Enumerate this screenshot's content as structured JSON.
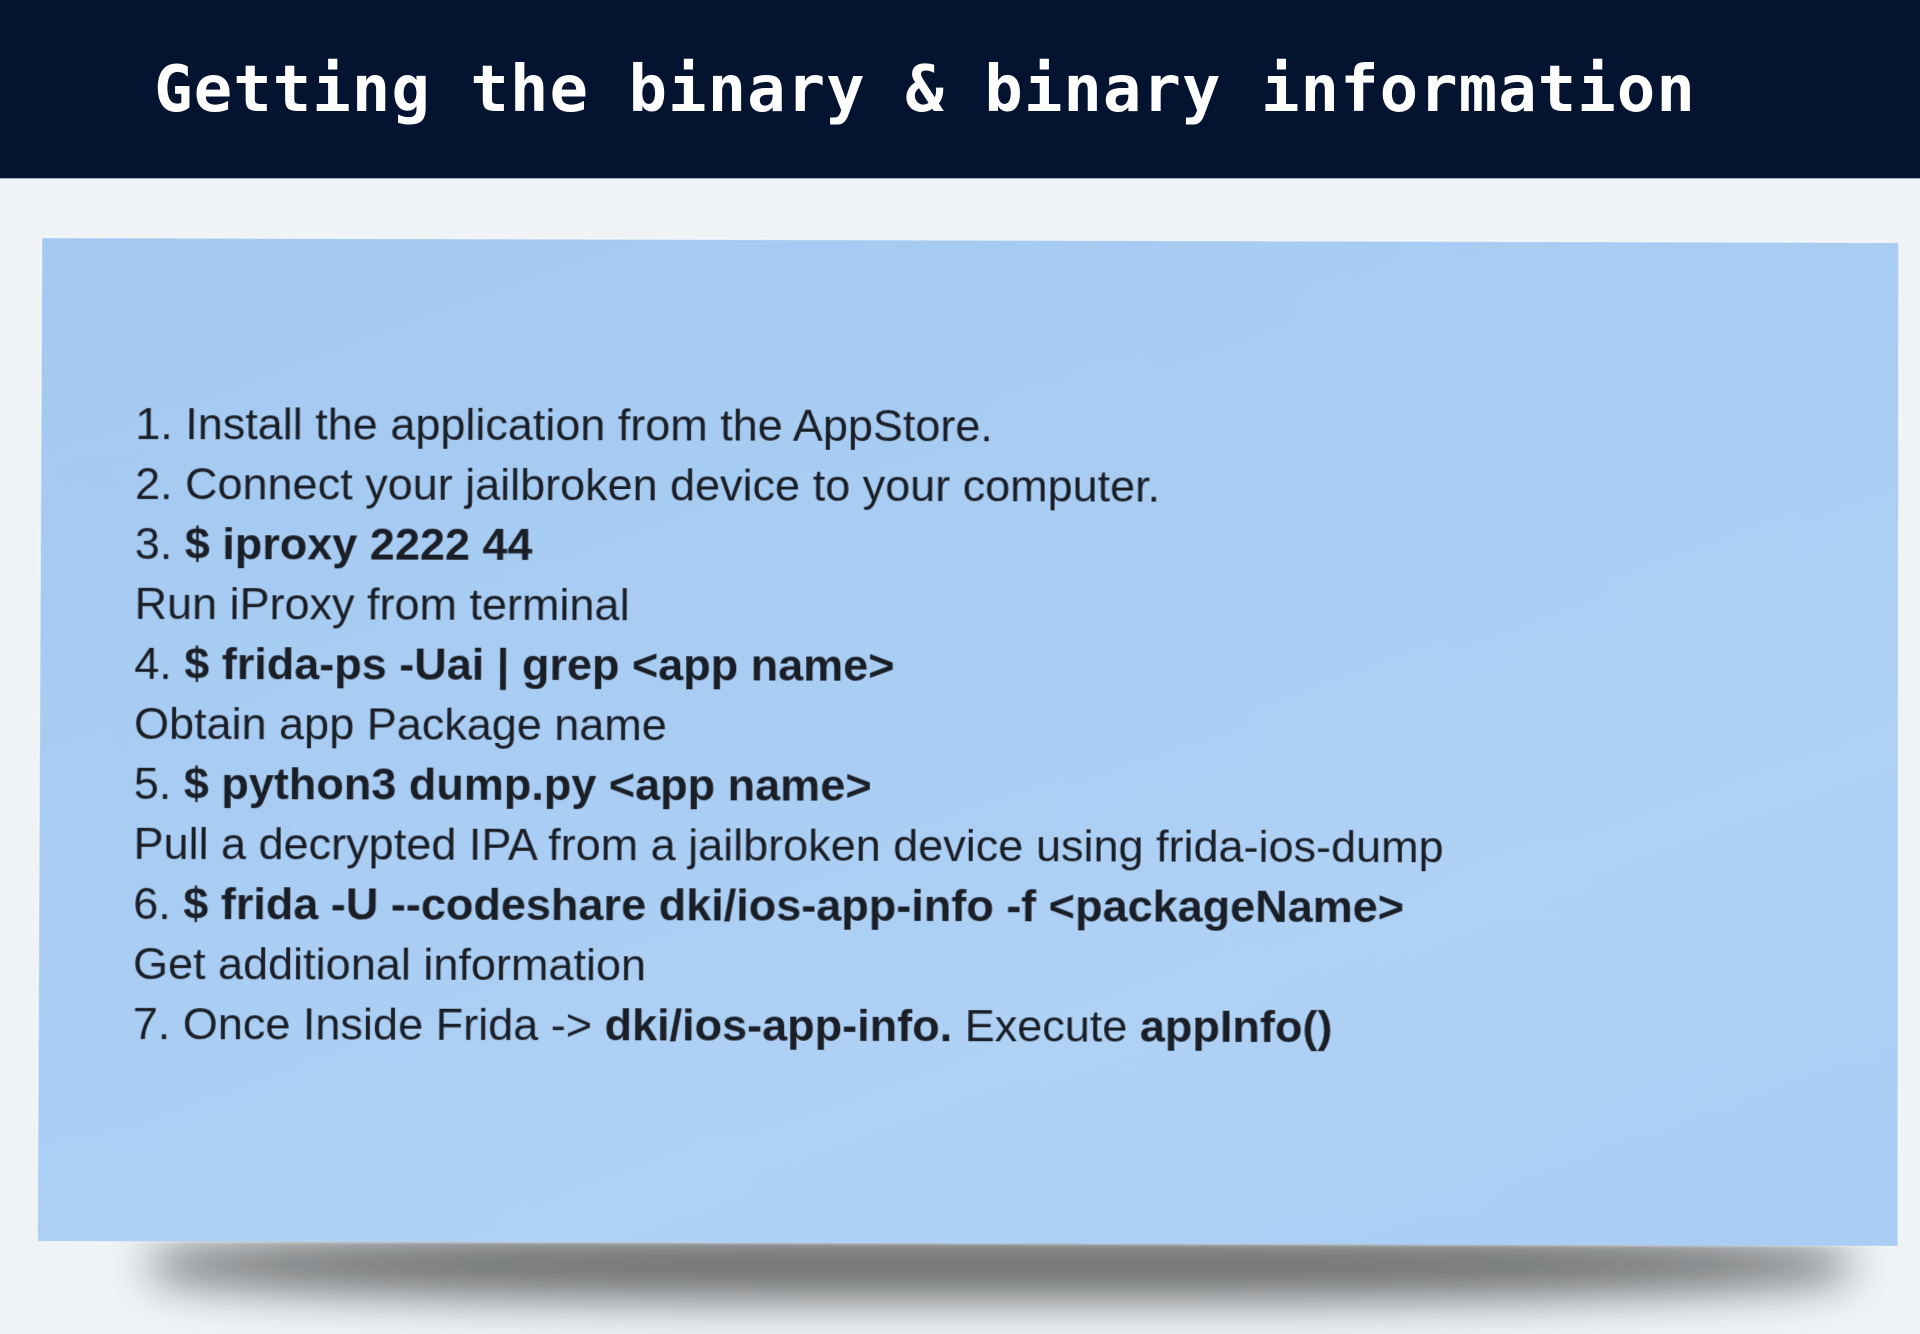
{
  "header": {
    "title": "Getting the binary & binary information"
  },
  "colors": {
    "header_bg": "#041430",
    "header_text": "#ffffff",
    "page_bg": "#eff3f6",
    "card_bg": "#a9cdf3",
    "body_text": "#1a1e26"
  },
  "steps": [
    {
      "prefix": "1. Install the application from the AppStore.",
      "cmd": "",
      "mid": "",
      "cmd2": ""
    },
    {
      "prefix": "2. Connect your jailbroken device to your computer.",
      "cmd": "",
      "mid": "",
      "cmd2": ""
    },
    {
      "prefix": "3. ",
      "cmd": "$ iproxy 2222 44",
      "mid": "",
      "cmd2": ""
    },
    {
      "prefix": "Run iProxy from terminal",
      "cmd": "",
      "mid": "",
      "cmd2": ""
    },
    {
      "prefix": "4. ",
      "cmd": "$ frida-ps -Uai | grep <app name>",
      "mid": "",
      "cmd2": ""
    },
    {
      "prefix": "Obtain app Package name",
      "cmd": "",
      "mid": "",
      "cmd2": ""
    },
    {
      "prefix": "5. ",
      "cmd": "$ python3 dump.py <app name>",
      "mid": "",
      "cmd2": ""
    },
    {
      "prefix": "Pull a decrypted IPA from a jailbroken device using frida-ios-dump",
      "cmd": "",
      "mid": "",
      "cmd2": ""
    },
    {
      "prefix": "6. ",
      "cmd": "$ frida -U --codeshare dki/ios-app-info -f <packageName>",
      "mid": "",
      "cmd2": ""
    },
    {
      "prefix": "Get additional information",
      "cmd": "",
      "mid": "",
      "cmd2": ""
    },
    {
      "prefix": "7. Once Inside Frida -> ",
      "cmd": "dki/ios-app-info.",
      "mid": " Execute ",
      "cmd2": "appInfo()"
    }
  ]
}
